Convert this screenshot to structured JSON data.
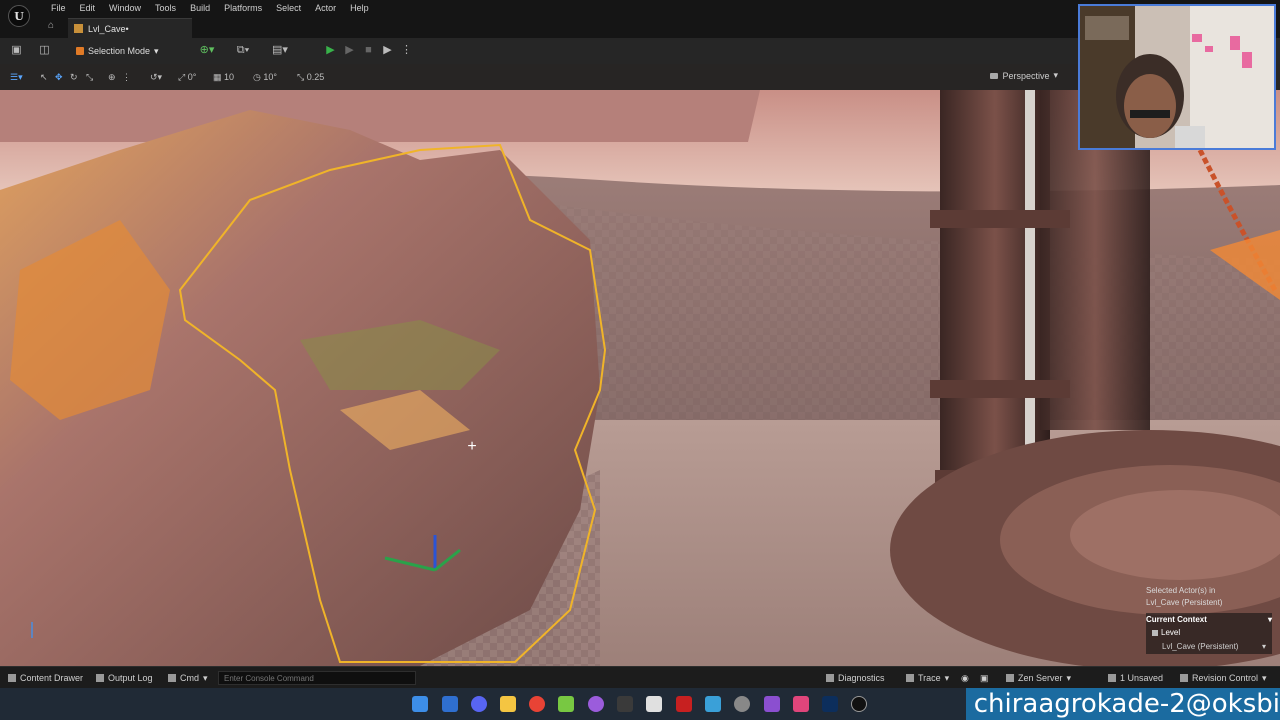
{
  "menu": {
    "logo": "U",
    "items": [
      "File",
      "Edit",
      "Window",
      "Tools",
      "Build",
      "Platforms",
      "Select",
      "Actor",
      "Help"
    ]
  },
  "tab": {
    "label": "Lvl_Cave•"
  },
  "toolbar": {
    "mode_label": "Selection Mode"
  },
  "viewport_toolbar": {
    "rotation_snap_value": "0°",
    "grid_snap_value": "10",
    "angle_snap_value": "10°",
    "scale_snap_value": "0.25",
    "view_mode": "Perspective"
  },
  "outliner_overlay": {
    "selected_text": "Selected Actor(s) in",
    "selected_level": "Lvl_Cave (Persistent)",
    "context_title": "Current Context",
    "level_label": "Level",
    "level_value": "Lvl_Cave (Persistent)"
  },
  "statusbar": {
    "content_drawer": "Content Drawer",
    "output_log": "Output Log",
    "cmd": "Cmd",
    "console_placeholder": "Enter Console Command",
    "diagnostics": "Diagnostics",
    "trace": "Trace",
    "zen_server": "Zen Server",
    "unsaved": "1 Unsaved",
    "revision_control": "Revision Control"
  },
  "watermark": "chiraagrokade-2@oksbi",
  "colors": {
    "accent_orange": "#e07a26",
    "play_green": "#38b24a",
    "selection_outline": "#f0b429",
    "webcam_border": "#4a7bd8",
    "watermark_bg": "#1b6ba0"
  }
}
